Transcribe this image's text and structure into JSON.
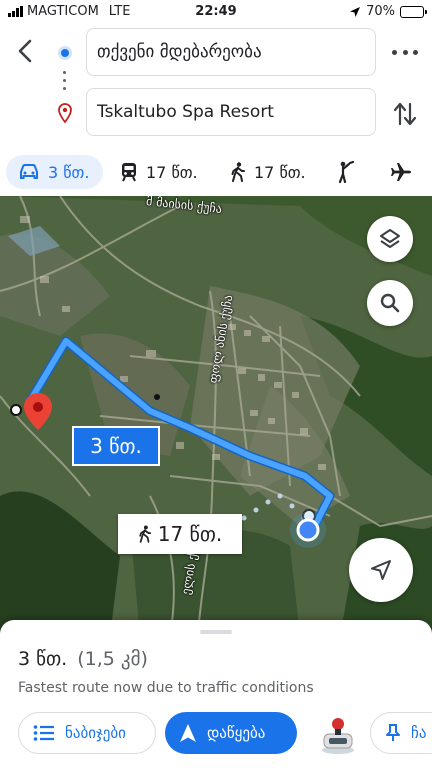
{
  "status_bar": {
    "carrier": "MAGTICOM",
    "network": "LTE",
    "time": "22:49",
    "battery": "70%",
    "battery_level": 0.7
  },
  "header": {
    "origin_value": "თქვენი მდებარეობა",
    "destination_value": "Tskaltubo Spa Resort",
    "origin_icon": "origin-dot-icon",
    "destination_icon": "location-pin-icon"
  },
  "modes": [
    {
      "id": "driving",
      "icon": "car-icon",
      "label": "3 წთ.",
      "active": true
    },
    {
      "id": "transit",
      "icon": "train-icon",
      "label": "17 წთ.",
      "active": false
    },
    {
      "id": "walking",
      "icon": "walk-icon",
      "label": "17 წთ.",
      "active": false
    },
    {
      "id": "ride",
      "icon": "hail-icon",
      "label": "",
      "active": false
    },
    {
      "id": "flight",
      "icon": "plane-icon",
      "label": "",
      "active": false
    }
  ],
  "map": {
    "road_label_1": "მ მაისის ქუჩა",
    "road_label_2": "ფოლ ანის ქუჩა",
    "road_label_3": "ელის ქუ",
    "car_time": "3 წთ.",
    "walk_time": "17 წთ.",
    "route_color": "#4aa3ff",
    "pin_color": "#ea4335"
  },
  "sheet": {
    "duration": "3 წთ.",
    "distance": "(1,5 კმ)",
    "note": "Fastest route now due to traffic conditions",
    "steps_label": "ნაბიჯები",
    "start_label": "დაწყება",
    "share_label": "ჩა"
  }
}
